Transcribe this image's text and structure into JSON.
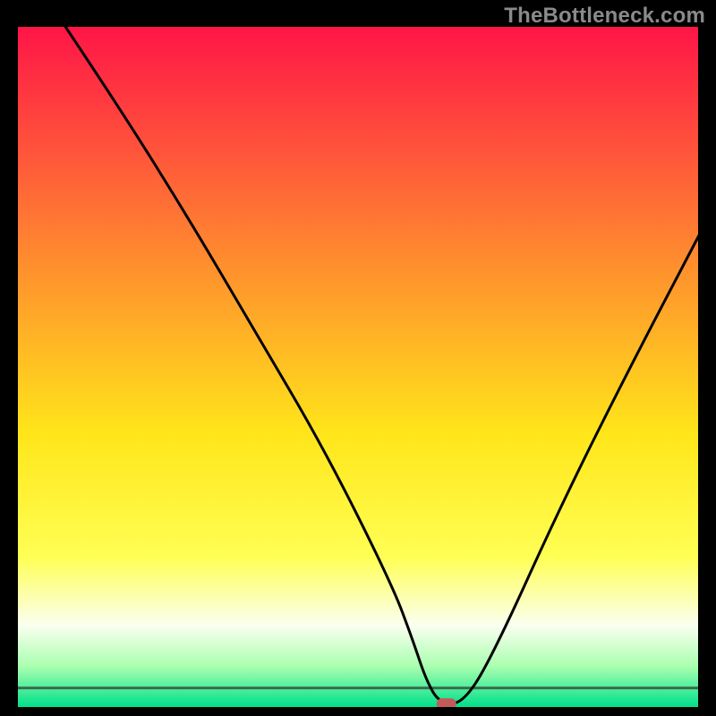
{
  "watermark": "TheBottleneck.com",
  "chart_data": {
    "type": "line",
    "title": "",
    "xlabel": "",
    "ylabel": "",
    "xlim": [
      0,
      100
    ],
    "ylim": [
      0,
      100
    ],
    "grid": false,
    "series": [
      {
        "name": "curve",
        "x": [
          7,
          15,
          25,
          35,
          45,
          55,
          58,
          60,
          62,
          65.5,
          70,
          80,
          90,
          101
        ],
        "y": [
          100,
          88,
          72,
          55,
          38,
          18,
          10,
          4,
          0.5,
          0.5,
          8,
          30,
          50,
          71
        ]
      }
    ],
    "marker": {
      "x": 63,
      "y": 0.5,
      "color": "#c25a5a"
    },
    "background_gradient_stops": [
      {
        "offset": 0.0,
        "color": "#ff1547"
      },
      {
        "offset": 0.2,
        "color": "#ff5a3a"
      },
      {
        "offset": 0.4,
        "color": "#ffa02a"
      },
      {
        "offset": 0.6,
        "color": "#ffe61a"
      },
      {
        "offset": 0.78,
        "color": "#ffff55"
      },
      {
        "offset": 0.88,
        "color": "#fafff0"
      },
      {
        "offset": 0.94,
        "color": "#aaffb0"
      },
      {
        "offset": 1.0,
        "color": "#00e08a"
      }
    ],
    "background_thin_band": {
      "y": 0.03,
      "color": "#3c6a4a"
    }
  }
}
